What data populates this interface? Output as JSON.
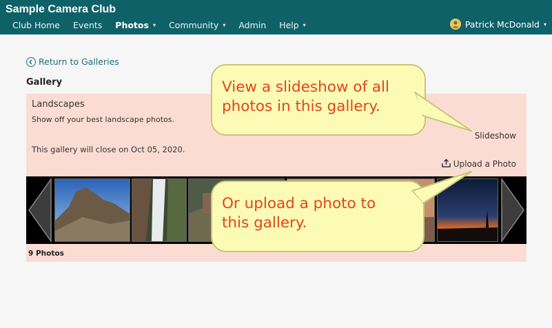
{
  "header": {
    "club_title": "Sample Camera Club",
    "nav": [
      {
        "label": "Club Home",
        "dropdown": false,
        "active": false
      },
      {
        "label": "Events",
        "dropdown": false,
        "active": false
      },
      {
        "label": "Photos",
        "dropdown": true,
        "active": true
      },
      {
        "label": "Community",
        "dropdown": true,
        "active": false
      },
      {
        "label": "Admin",
        "dropdown": false,
        "active": false
      },
      {
        "label": "Help",
        "dropdown": true,
        "active": false
      }
    ],
    "user_name": "Patrick McDonald",
    "caret": "▾"
  },
  "main": {
    "back_label": "Return to Galleries",
    "section_title": "Gallery",
    "gallery": {
      "name": "Landscapes",
      "description": "Show off your best landscape photos.",
      "close_notice": "This gallery will close on Oct 05, 2020.",
      "slideshow_label": "Slideshow",
      "upload_label": "Upload a Photo",
      "photo_count": "9 Photos"
    }
  },
  "callouts": {
    "slideshow": "View a slideshow of all\nphotos in this gallery.",
    "upload": "Or upload a photo to\nthis gallery."
  },
  "colors": {
    "header_bg": "#0f6168",
    "link": "#1a6f78",
    "card_bg": "#fbdcd2",
    "callout_bg": "#fbfbb6",
    "callout_text": "#e2451d"
  }
}
